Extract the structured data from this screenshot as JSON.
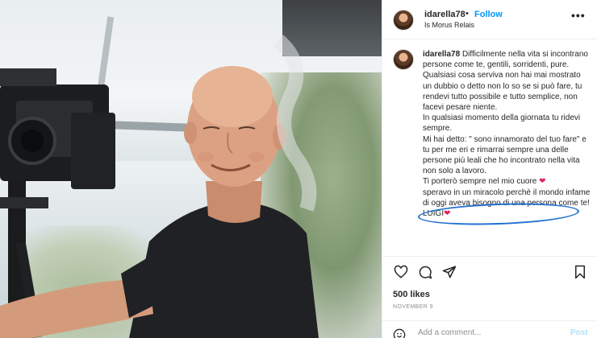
{
  "post": {
    "photo_alt": "",
    "header": {
      "username": "idarella78",
      "separator": "•",
      "follow_label": "Follow",
      "location": "Is Morus Relais",
      "more_icon": "more-horizontal-icon"
    },
    "caption": {
      "username": "idarella78",
      "lines": [
        "Difficilmente nella vita si incontrano persone come te, gentili, sorridenti, pure.",
        "Qualsiasi cosa serviva non hai mai mostrato un dubbio o detto non lo so se si può fare, tu rendevi tutto possibile e tutto semplice, non facevi pesare niente.",
        "In qualsiasi momento della giornata tu ridevi sempre.",
        "Mi hai detto: \" sono innamorato del tuo fare\" e tu per me eri e rimarrai sempre una delle persone più leali che ho incontrato nella vita non solo a lavoro."
      ],
      "highlight_line": "Ti porterò sempre nel mio cuore",
      "tail_line": "speravo in un miracolo perchè il mondo infame di oggi aveva bisogno di una persona come te! LUIGI",
      "heart_glyph": "❤"
    },
    "actions": {
      "like_icon": "heart-icon",
      "comment_icon": "comment-icon",
      "share_icon": "share-icon",
      "save_icon": "bookmark-icon"
    },
    "likes": "500 likes",
    "date": "NOVEMBER 9",
    "comment": {
      "placeholder": "Add a comment...",
      "post_label": "Post",
      "emoji_icon": "emoji-icon"
    }
  },
  "colors": {
    "accent": "#0095f6",
    "heart": "#e0245e",
    "annotation_circle": "#1f6fd1"
  }
}
